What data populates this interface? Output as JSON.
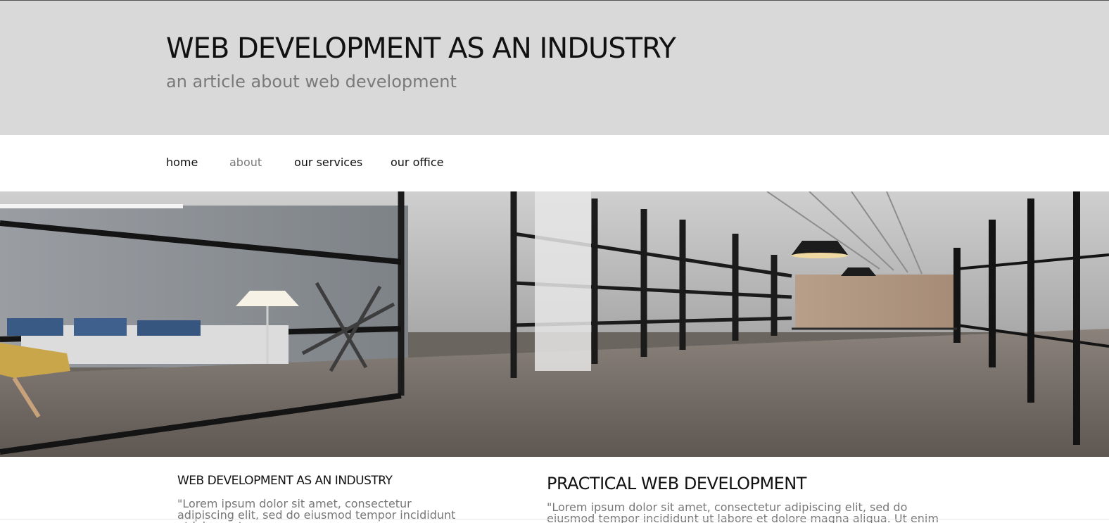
{
  "header": {
    "title": "WEB DEVELOPMENT AS AN INDUSTRY",
    "subtitle": "an article about web development"
  },
  "nav": {
    "items": [
      {
        "label": "home",
        "active": false
      },
      {
        "label": "about",
        "active": true
      },
      {
        "label": "our services",
        "active": false
      },
      {
        "label": "our office",
        "active": false
      }
    ]
  },
  "hero": {
    "image": "office-interior-photo"
  },
  "content": {
    "left": {
      "title": "WEB DEVELOPMENT AS AN INDUSTRY",
      "text": "\"Lorem ipsum dolor sit amet, consectetur adipiscing elit, sed do eiusmod tempor incididunt ut labore et"
    },
    "right": {
      "title": "PRACTICAL WEB DEVELOPMENT",
      "text": "\"Lorem ipsum dolor sit amet, consectetur adipiscing elit, sed do eiusmod tempor incididunt ut labore et dolore magna aliqua. Ut enim ad minim"
    }
  },
  "colors": {
    "header_bg": "#d9d9d9",
    "title": "#111111",
    "muted": "#7a7a7a",
    "page_bg": "#ffffff"
  }
}
